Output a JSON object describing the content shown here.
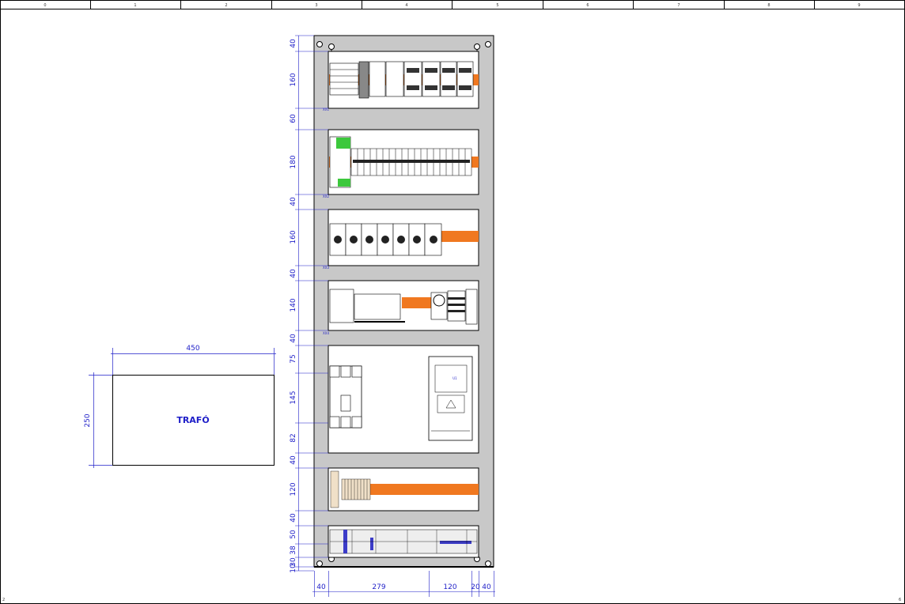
{
  "ruler": {
    "columns": [
      "0",
      "1",
      "2",
      "3",
      "4",
      "5",
      "6",
      "7",
      "8",
      "9"
    ]
  },
  "corners": {
    "left": "2",
    "right": "6"
  },
  "trafo": {
    "label": "TRAFÓ",
    "width": "450",
    "height": "250"
  },
  "cabinet": {
    "vertical_dims": [
      "40",
      "160",
      "60",
      "180",
      "40",
      "160",
      "40",
      "140",
      "40",
      "75",
      "145",
      "82",
      "40",
      "120",
      "40",
      "50",
      "38",
      "30",
      "10"
    ],
    "bottom_dims": [
      "40",
      "279",
      "120",
      "20",
      "40"
    ],
    "rail_tags": [
      "XX1",
      "XX2",
      "XX3",
      "XX4"
    ],
    "inverter_label": "U1"
  },
  "colors": {
    "dimension": "#1e1ec8",
    "panel": "#c8c8c8",
    "din_rail": "#f07820",
    "terminal_green": "#3cc83c"
  }
}
